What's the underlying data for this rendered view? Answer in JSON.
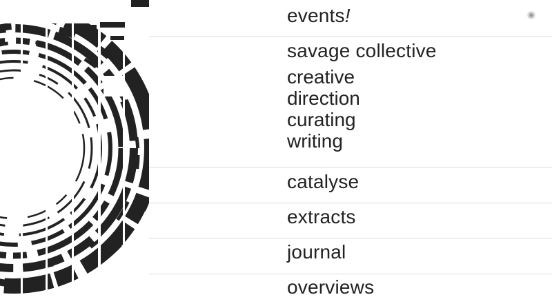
{
  "logo": {
    "icon": "concentric-arcs-logo",
    "color": "#222222"
  },
  "nav": {
    "events": {
      "label": "events",
      "suffix": "!"
    },
    "savage": {
      "label": "savage collective",
      "sub_items": [
        "creative",
        "direction",
        "curating",
        "writing"
      ]
    },
    "catalyse": {
      "label": "catalyse"
    },
    "extracts": {
      "label": "extracts"
    },
    "journal": {
      "label": "journal"
    },
    "overviews": {
      "label": "overviews"
    }
  },
  "corner_icon": "loading-spinner-icon"
}
